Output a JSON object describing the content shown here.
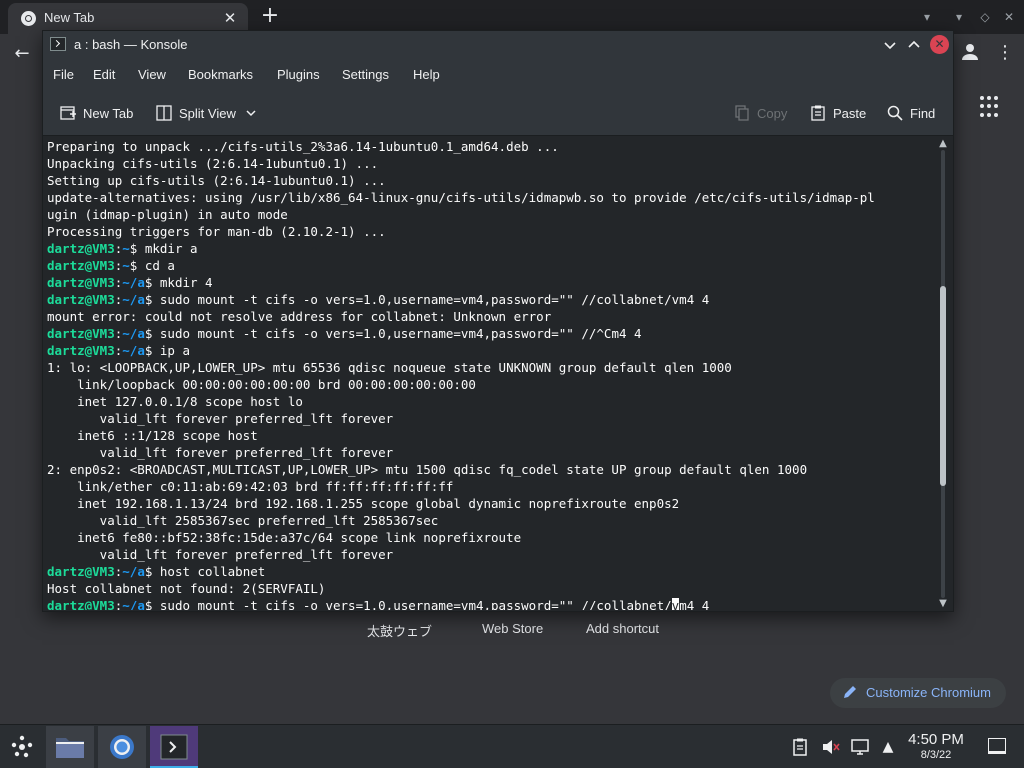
{
  "chromium": {
    "tab_title": "New Tab",
    "tab_close": "✕",
    "new_tab": "+",
    "shortcuts": [
      "太鼓ウェブ",
      "Web Store",
      "Add shortcut"
    ],
    "customize_label": "Customize Chromium"
  },
  "konsole": {
    "title": "a : bash — Konsole",
    "menu": [
      "File",
      "Edit",
      "View",
      "Bookmarks",
      "Plugins",
      "Settings",
      "Help"
    ],
    "toolbar": {
      "new_tab": "New Tab",
      "split_view": "Split View",
      "copy": "Copy",
      "paste": "Paste",
      "find": "Find"
    },
    "scroll_position": 0.55,
    "lines": [
      {
        "text": "Preparing to unpack .../cifs-utils_2%3a6.14-1ubuntu0.1_amd64.deb ..."
      },
      {
        "text": "Unpacking cifs-utils (2:6.14-1ubuntu0.1) ..."
      },
      {
        "text": "Setting up cifs-utils (2:6.14-1ubuntu0.1) ..."
      },
      {
        "text": "update-alternatives: using /usr/lib/x86_64-linux-gnu/cifs-utils/idmapwb.so to provide /etc/cifs-utils/idmap-pl"
      },
      {
        "text": "ugin (idmap-plugin) in auto mode"
      },
      {
        "text": "Processing triggers for man-db (2.10.2-1) ..."
      },
      {
        "user": "dartz@VM3",
        "path": "~",
        "cmd": "mkdir a"
      },
      {
        "user": "dartz@VM3",
        "path": "~",
        "cmd": "cd a"
      },
      {
        "user": "dartz@VM3",
        "path": "~/a",
        "cmd": "mkdir 4"
      },
      {
        "user": "dartz@VM3",
        "path": "~/a",
        "cmd": "sudo mount -t cifs -o vers=1.0,username=vm4,password=\"\" //collabnet/vm4 4"
      },
      {
        "text": "mount error: could not resolve address for collabnet: Unknown error"
      },
      {
        "user": "dartz@VM3",
        "path": "~/a",
        "cmd": "sudo mount -t cifs -o vers=1.0,username=vm4,password=\"\" //^Cm4 4"
      },
      {
        "user": "dartz@VM3",
        "path": "~/a",
        "cmd": "ip a"
      },
      {
        "text": "1: lo: <LOOPBACK,UP,LOWER_UP> mtu 65536 qdisc noqueue state UNKNOWN group default qlen 1000"
      },
      {
        "text": "    link/loopback 00:00:00:00:00:00 brd 00:00:00:00:00:00"
      },
      {
        "text": "    inet 127.0.0.1/8 scope host lo"
      },
      {
        "text": "       valid_lft forever preferred_lft forever"
      },
      {
        "text": "    inet6 ::1/128 scope host"
      },
      {
        "text": "       valid_lft forever preferred_lft forever"
      },
      {
        "text": "2: enp0s2: <BROADCAST,MULTICAST,UP,LOWER_UP> mtu 1500 qdisc fq_codel state UP group default qlen 1000"
      },
      {
        "text": "    link/ether c0:11:ab:69:42:03 brd ff:ff:ff:ff:ff:ff"
      },
      {
        "text": "    inet 192.168.1.13/24 brd 192.168.1.255 scope global dynamic noprefixroute enp0s2"
      },
      {
        "text": "       valid_lft 2585367sec preferred_lft 2585367sec"
      },
      {
        "text": "    inet6 fe80::bf52:38fc:15de:a37c/64 scope link noprefixroute"
      },
      {
        "text": "       valid_lft forever preferred_lft forever"
      },
      {
        "user": "dartz@VM3",
        "path": "~/a",
        "cmd": "host collabnet"
      },
      {
        "text": "Host collabnet not found: 2(SERVFAIL)"
      },
      {
        "user": "dartz@VM3",
        "path": "~/a",
        "cmd_before": "sudo mount -t cifs -o vers=1.0,username=vm4,password=\"\" //collabnet/",
        "cursor": "v",
        "cmd_after": "m4 4"
      }
    ]
  },
  "panel": {
    "time": "4:50 PM",
    "date": "8/3/22"
  },
  "colors": {
    "prompt_user": "#1cdc9a",
    "prompt_path": "#1d99f3",
    "close_button": "#da4453",
    "customize_text": "#8ab4f8"
  }
}
